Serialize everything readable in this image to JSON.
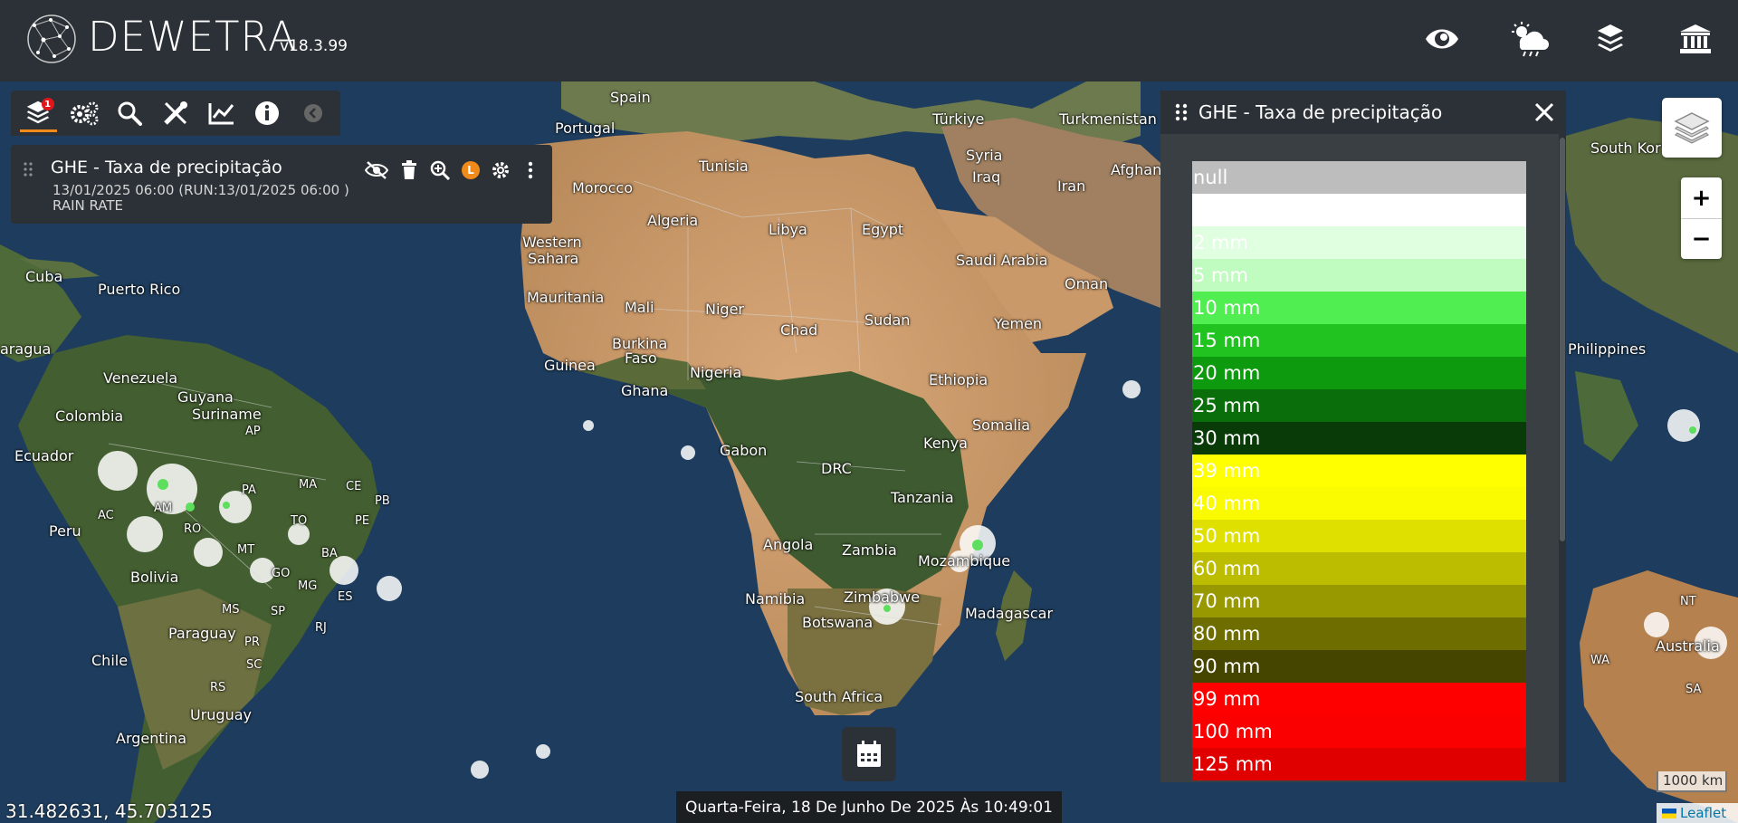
{
  "header": {
    "brand": "DEWETRA",
    "version": "v18.3.99",
    "buttons": [
      {
        "icon": "eye-icon"
      },
      {
        "icon": "weather-rain-icon"
      },
      {
        "icon": "layers-stack-icon"
      },
      {
        "icon": "bank-icon"
      }
    ]
  },
  "toolbar": {
    "layers_badge": "1",
    "icons": [
      "layers-icon",
      "gears-icon",
      "search-icon",
      "tools-icon",
      "chart-icon",
      "info-icon",
      "collapse-icon"
    ]
  },
  "layer_card": {
    "title": "GHE - Taxa de precipitação",
    "date": "13/01/2025 06:00 (RUN:13/01/2025 06:00 )",
    "variable": "RAIN RATE",
    "legend_letter": "L"
  },
  "legend": {
    "title": "GHE - Taxa de precipitação",
    "rows": [
      {
        "label": "null",
        "color": "#bdbdbd"
      },
      {
        "label": "",
        "color": "#ffffff"
      },
      {
        "label": "2 mm",
        "color": "#e0fee0"
      },
      {
        "label": "5 mm",
        "color": "#c0fcc0"
      },
      {
        "label": "10 mm",
        "color": "#50ee50"
      },
      {
        "label": "15 mm",
        "color": "#21c321"
      },
      {
        "label": "20 mm",
        "color": "#0e9a0e"
      },
      {
        "label": "25 mm",
        "color": "#0a6e0a"
      },
      {
        "label": "30 mm",
        "color": "#083b08"
      },
      {
        "label": "39 mm",
        "color": "#ffff00"
      },
      {
        "label": "40 mm",
        "color": "#fafa00"
      },
      {
        "label": "50 mm",
        "color": "#e0e000"
      },
      {
        "label": "60 mm",
        "color": "#bcbc00"
      },
      {
        "label": "70 mm",
        "color": "#989800"
      },
      {
        "label": "80 mm",
        "color": "#6e6e00"
      },
      {
        "label": "90 mm",
        "color": "#454500"
      },
      {
        "label": "99 mm",
        "color": "#ff0000"
      },
      {
        "label": "100 mm",
        "color": "#fb0000"
      },
      {
        "label": "125 mm",
        "color": "#e00000"
      }
    ]
  },
  "map": {
    "labels": [
      {
        "text": "Spain"
      },
      {
        "text": "Portugal"
      },
      {
        "text": "Türkiye"
      },
      {
        "text": "Turkmenistan"
      },
      {
        "text": "Tunisia"
      },
      {
        "text": "Syria"
      },
      {
        "text": "Afghani"
      },
      {
        "text": "Morocco"
      },
      {
        "text": "Iraq"
      },
      {
        "text": "Iran"
      },
      {
        "text": "Algeria"
      },
      {
        "text": "Libya"
      },
      {
        "text": "Egypt"
      },
      {
        "text": "Western"
      },
      {
        "text": "Sahara"
      },
      {
        "text": "Saudi Arabia"
      },
      {
        "text": "Oman"
      },
      {
        "text": "Cuba"
      },
      {
        "text": "Mauritania"
      },
      {
        "text": "Mali"
      },
      {
        "text": "Niger"
      },
      {
        "text": "Puerto Rico"
      },
      {
        "text": "Chad"
      },
      {
        "text": "Sudan"
      },
      {
        "text": "Yemen"
      },
      {
        "text": "Burkina"
      },
      {
        "text": "Faso"
      },
      {
        "text": "aragua"
      },
      {
        "text": "Guinea"
      },
      {
        "text": "Nigeria"
      },
      {
        "text": "Ghana"
      },
      {
        "text": "Ethiopia"
      },
      {
        "text": "Venezuela"
      },
      {
        "text": "Guyana"
      },
      {
        "text": "Suriname"
      },
      {
        "text": "Colombia"
      },
      {
        "text": "AP"
      },
      {
        "text": "Somalia"
      },
      {
        "text": "Ecuador"
      },
      {
        "text": "Gabon"
      },
      {
        "text": "Kenya"
      },
      {
        "text": "DRC"
      },
      {
        "text": "PA"
      },
      {
        "text": "MA"
      },
      {
        "text": "CE"
      },
      {
        "text": "AM"
      },
      {
        "text": "PB"
      },
      {
        "text": "Tanzania"
      },
      {
        "text": "Peru"
      },
      {
        "text": "AC"
      },
      {
        "text": "RO"
      },
      {
        "text": "TO"
      },
      {
        "text": "PE"
      },
      {
        "text": "MT"
      },
      {
        "text": "BA"
      },
      {
        "text": "Angola"
      },
      {
        "text": "Zambia"
      },
      {
        "text": "Bolivia"
      },
      {
        "text": "GO"
      },
      {
        "text": "MG"
      },
      {
        "text": "ES"
      },
      {
        "text": "Mozambique"
      },
      {
        "text": "Namibia"
      },
      {
        "text": "Zimbabwe"
      },
      {
        "text": "MS"
      },
      {
        "text": "SP"
      },
      {
        "text": "RJ"
      },
      {
        "text": "Paraguay"
      },
      {
        "text": "PR"
      },
      {
        "text": "Madagascar"
      },
      {
        "text": "Botswana"
      },
      {
        "text": "SC"
      },
      {
        "text": "RS"
      },
      {
        "text": "Chile"
      },
      {
        "text": "Uruguay"
      },
      {
        "text": "South Africa"
      },
      {
        "text": "Argentina"
      },
      {
        "text": "South Kor"
      },
      {
        "text": "Philippines"
      },
      {
        "text": "NT"
      },
      {
        "text": "Australia"
      },
      {
        "text": "WA"
      },
      {
        "text": "SA"
      }
    ]
  },
  "footer": {
    "coords": "31.482631, 45.703125",
    "datetime": "Quarta-Feira, 18 De Junho De 2025 Às 10:49:01",
    "scale": "1000 km",
    "attribution": "Leaflet"
  },
  "colors": {
    "panel": "#2b3137",
    "accent": "#f08a1a",
    "badge": "#e0161b"
  }
}
